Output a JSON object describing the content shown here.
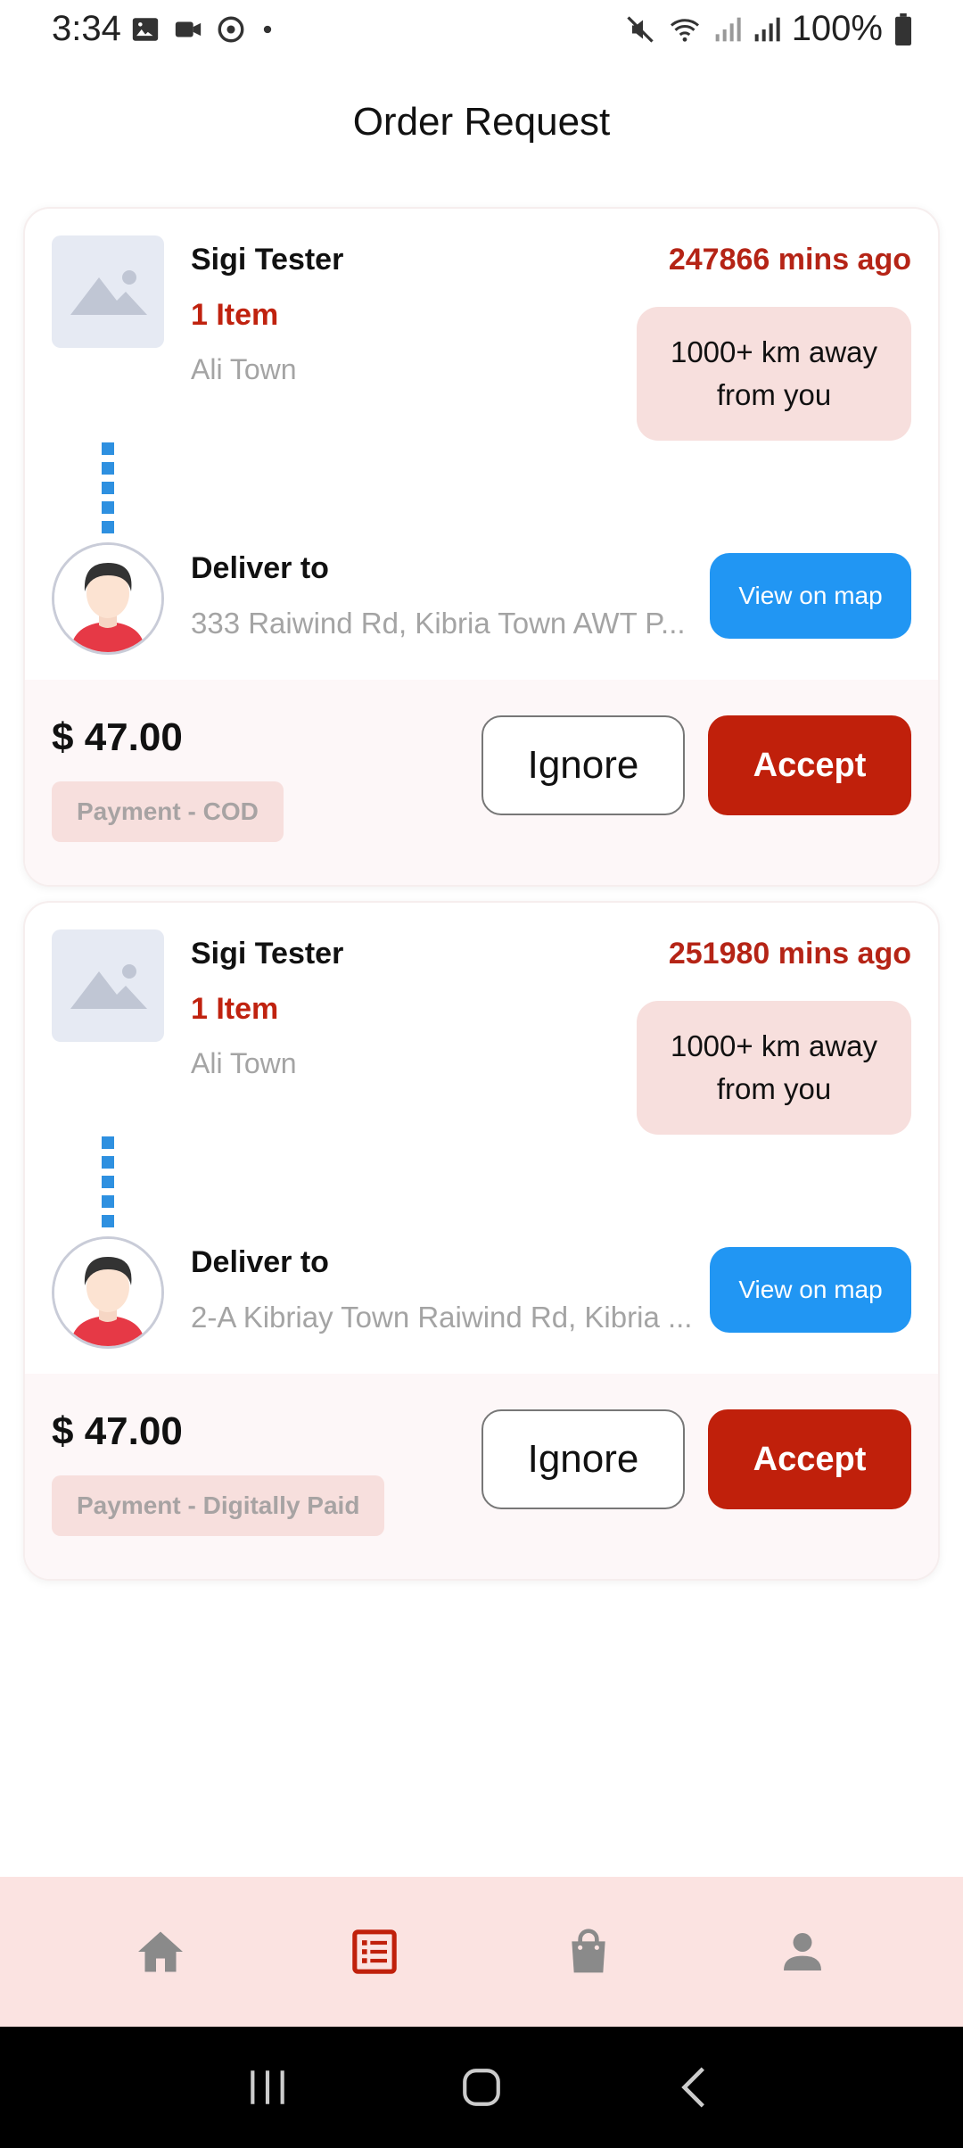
{
  "status_bar": {
    "time": "3:34",
    "battery": "100%"
  },
  "header": {
    "title": "Order Request"
  },
  "orders": [
    {
      "customer": "Sigi Tester",
      "items": "1 Item",
      "area": "Ali Town",
      "time_ago": "247866 mins ago",
      "distance": "1000+ km away from you",
      "deliver_label": "Deliver to",
      "address": "333 Raiwind Rd, Kibria Town AWT P...",
      "map_label": "View on map",
      "price": "$ 47.00",
      "payment": "Payment - COD",
      "ignore_label": "Ignore",
      "accept_label": "Accept"
    },
    {
      "customer": "Sigi Tester",
      "items": "1 Item",
      "area": "Ali Town",
      "time_ago": "251980 mins ago",
      "distance": "1000+ km away from you",
      "deliver_label": "Deliver to",
      "address": "2-A Kibriay Town Raiwind Rd, Kibria ...",
      "map_label": "View on map",
      "price": "$ 47.00",
      "payment": "Payment - Digitally Paid",
      "ignore_label": "Ignore",
      "accept_label": "Accept"
    }
  ],
  "bottom_nav": {
    "items": [
      {
        "icon": "home-icon",
        "active": false
      },
      {
        "icon": "orders-list-icon",
        "active": true
      },
      {
        "icon": "shopping-bag-icon",
        "active": false
      },
      {
        "icon": "profile-icon",
        "active": false
      }
    ],
    "active_color": "#c0200b",
    "inactive_color": "#8a8a8a"
  },
  "colors": {
    "accent": "#c0200b",
    "map_button": "#2196f3",
    "time_text": "#b52416",
    "chip_bg": "#f7dfdd"
  }
}
